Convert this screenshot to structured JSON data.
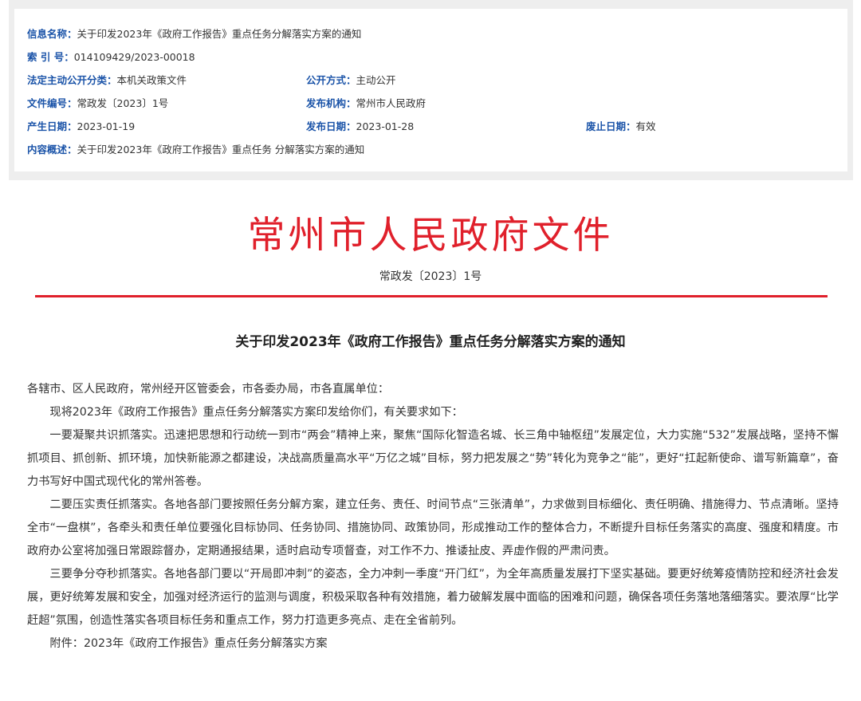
{
  "info": {
    "name_label": "信息名称：",
    "name_value": "关于印发2023年《政府工作报告》重点任务分解落实方案的通知",
    "index_label": "索 引 号：",
    "index_value": "014109429/2023-00018",
    "category_label": "法定主动公开分类：",
    "category_value": "本机关政策文件",
    "disclosure_label": "公开方式：",
    "disclosure_value": "主动公开",
    "docno_label": "文件编号：",
    "docno_value": "常政发〔2023〕1号",
    "issuer_label": "发布机构：",
    "issuer_value": "常州市人民政府",
    "created_label": "产生日期：",
    "created_value": "2023-01-19",
    "published_label": "发布日期：",
    "published_value": "2023-01-28",
    "expiry_label": "废止日期：",
    "expiry_value": "有效",
    "summary_label": "内容概述：",
    "summary_value": "关于印发2023年《政府工作报告》重点任务 分解落实方案的通知"
  },
  "document": {
    "title": "常州市人民政府文件",
    "number": "常政发〔2023〕1号",
    "notice_title": "关于印发2023年《政府工作报告》重点任务分解落实方案的通知",
    "addressee": "各辖市、区人民政府，常州经开区管委会，市各委办局，市各直属单位：",
    "intro": "现将2023年《政府工作报告》重点任务分解落实方案印发给你们，有关要求如下：",
    "para1": "一要凝聚共识抓落实。迅速把思想和行动统一到市“两会”精神上来，聚焦“国际化智造名城、长三角中轴枢纽”发展定位，大力实施“532”发展战略，坚持不懈抓项目、抓创新、抓环境，加快新能源之都建设，决战高质量高水平“万亿之城”目标，努力把发展之“势”转化为竞争之“能”，更好“扛起新使命、谱写新篇章”，奋力书写好中国式现代化的常州答卷。",
    "para2": "二要压实责任抓落实。各地各部门要按照任务分解方案，建立任务、责任、时间节点“三张清单”，力求做到目标细化、责任明确、措施得力、节点清晰。坚持全市“一盘棋”，各牵头和责任单位要强化目标协同、任务协同、措施协同、政策协同，形成推动工作的整体合力，不断提升目标任务落实的高度、强度和精度。市政府办公室将加强日常跟踪督办，定期通报结果，适时启动专项督查，对工作不力、推诿扯皮、弄虚作假的严肃问责。",
    "para3": "三要争分夺秒抓落实。各地各部门要以“开局即冲刺”的姿态，全力冲刺一季度“开门红”，为全年高质量发展打下坚实基础。要更好统筹疫情防控和经济社会发展，更好统筹发展和安全，加强对经济运行的监测与调度，积极采取各种有效措施，着力破解发展中面临的困难和问题，确保各项任务落地落细落实。要浓厚“比学赶超”氛围，创造性落实各项目标任务和重点工作，努力打造更多亮点、走在全省前列。",
    "attachment": "附件：2023年《政府工作报告》重点任务分解落实方案"
  }
}
